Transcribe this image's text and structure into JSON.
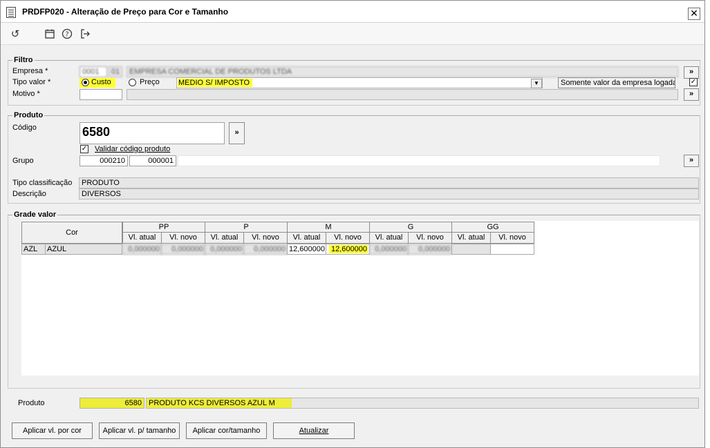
{
  "window": {
    "title": "PRDFP020 - Alteração de Preço para Cor e Tamanho"
  },
  "toolbar": {
    "icons": [
      "refresh-icon",
      "calendar-icon",
      "help-icon",
      "exit-icon"
    ]
  },
  "filtro": {
    "legend": "Filtro",
    "empresa_label": "Empresa *",
    "tipo_valor_label": "Tipo valor *",
    "custo_label": "Custo",
    "preco_label": "Preço",
    "tipo_valor_selected": "MEDIO S/ IMPOSTO",
    "somente_label": "Somente valor da empresa logada",
    "motivo_label": "Motivo *",
    "more": "»"
  },
  "produto": {
    "legend": "Produto",
    "codigo_label": "Código",
    "codigo_value": "6580",
    "validar_label": "Validar código produto",
    "grupo_label": "Grupo",
    "grupo_1": "000210",
    "grupo_2": "000001",
    "tipo_label": "Tipo classificação",
    "tipo_value": "PRODUTO",
    "descricao_label": "Descrição",
    "descricao_value": "DIVERSOS",
    "more": "»"
  },
  "grade": {
    "legend": "Grade valor",
    "cor_header": "Cor",
    "sizes": [
      "PP",
      "P",
      "M",
      "G",
      "GG"
    ],
    "sub_atual": "Vl. atual",
    "sub_novo": "Vl. novo",
    "row": {
      "cor_code": "AZL",
      "cor_name": "AZUL",
      "m_atual": "12,600000",
      "m_novo": "12,600000"
    }
  },
  "bottom": {
    "produto_label": "Produto",
    "produto_code": "6580",
    "produto_desc": "PRODUTO KCS DIVERSOS AZUL M"
  },
  "buttons": {
    "por_cor": "Aplicar vl. por cor",
    "por_tamanho": "Aplicar vl. p/ tamanho",
    "cor_tamanho": "Aplicar cor/tamanho",
    "atualizar": "Atualizar"
  }
}
